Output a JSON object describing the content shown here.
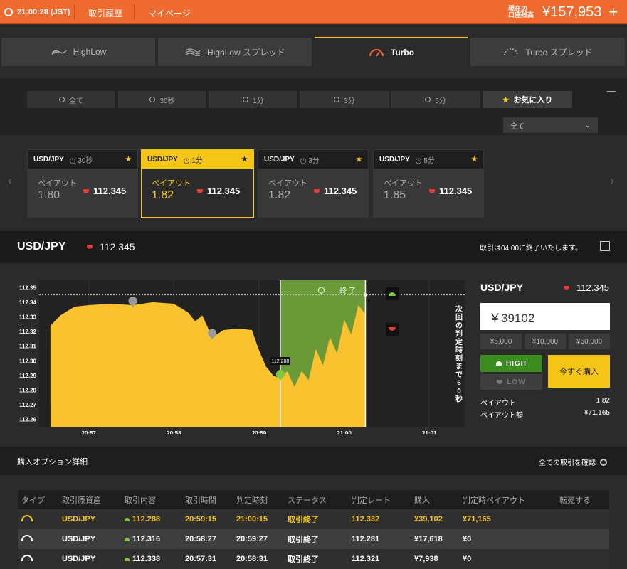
{
  "header": {
    "clock": "21:00:28 (JST)",
    "trade_history": "取引履歴",
    "my_page": "マイページ",
    "balance_label_line1": "現在の",
    "balance_label_line2": "口座残高",
    "balance": "¥157,953",
    "add_symbol": "+"
  },
  "tabs": [
    {
      "label": "HighLow"
    },
    {
      "label": "HighLow スプレッド"
    },
    {
      "label": "Turbo"
    },
    {
      "label": "Turbo スプレッド"
    }
  ],
  "filters": [
    {
      "label": "全て"
    },
    {
      "label": "30秒"
    },
    {
      "label": "1分"
    },
    {
      "label": "3分"
    },
    {
      "label": "5分"
    },
    {
      "label": "お気に入り"
    }
  ],
  "dropdown": {
    "value": "全て"
  },
  "cards": [
    {
      "pair": "USD/JPY",
      "duration": "30秒",
      "payout_label": "ペイアウト",
      "payout": "1.80",
      "rate": "112.345"
    },
    {
      "pair": "USD/JPY",
      "duration": "1分",
      "payout_label": "ペイアウト",
      "payout": "1.82",
      "rate": "112.345"
    },
    {
      "pair": "USD/JPY",
      "duration": "3分",
      "payout_label": "ペイアウト",
      "payout": "1.82",
      "rate": "112.345"
    },
    {
      "pair": "USD/JPY",
      "duration": "5分",
      "payout_label": "ペイアウト",
      "payout": "1.85",
      "rate": "112.345"
    }
  ],
  "pair_bar": {
    "pair": "USD/JPY",
    "rate": "112.345",
    "close_info": "取引は04:00に終了いたします。"
  },
  "chart": {
    "yticks": [
      "112.35",
      "112.34",
      "112.33",
      "112.32",
      "112.31",
      "112.30",
      "112.29",
      "112.28",
      "112.27",
      "112.26"
    ],
    "xticks": [
      "20:57",
      "20:58",
      "20:59",
      "21:00",
      "21:01"
    ],
    "end_label": "終 了",
    "countdown": "次回の判定時刻まで60秒",
    "entry_tag": "112.288"
  },
  "chart_data": {
    "type": "area",
    "ylim": [
      112.255,
      112.355
    ],
    "x": [
      "20:56:33",
      "20:56:40",
      "20:56:50",
      "20:57:00",
      "20:57:15",
      "20:57:31",
      "20:57:45",
      "20:58:00",
      "20:58:10",
      "20:58:15",
      "20:58:20",
      "20:58:27",
      "20:58:35",
      "20:58:45",
      "20:58:55",
      "20:59:00",
      "20:59:05",
      "20:59:10",
      "20:59:15",
      "20:59:20",
      "20:59:25",
      "20:59:30",
      "20:59:35",
      "20:59:40",
      "20:59:45",
      "20:59:50",
      "20:59:55",
      "21:00:00",
      "21:00:05",
      "21:00:10",
      "21:00:15"
    ],
    "values": [
      112.324,
      112.331,
      112.337,
      112.338,
      112.339,
      112.338,
      112.34,
      112.339,
      112.333,
      112.327,
      112.331,
      112.316,
      112.321,
      112.322,
      112.321,
      112.307,
      112.296,
      112.29,
      112.288,
      112.293,
      112.282,
      112.293,
      112.287,
      112.308,
      112.297,
      112.316,
      112.305,
      112.328,
      112.318,
      112.338,
      112.332
    ]
  },
  "trade_panel": {
    "pair": "USD/JPY",
    "rate": "112.345",
    "amount": "￥39102",
    "quick_amounts": [
      "¥5,000",
      "¥10,000",
      "¥50,000"
    ],
    "high": "HIGH",
    "low": "LOW",
    "buy": "今すぐ購入",
    "payout_label": "ペイアウト",
    "payout_value": "1.82",
    "payout_amount_label": "ペイアウト額",
    "payout_amount_value": "¥71,165"
  },
  "details": {
    "title": "購入オプション詳細",
    "link": "全ての取引を確認",
    "headers": [
      "タイプ",
      "取引原資産",
      "取引内容",
      "取引時間",
      "判定時刻",
      "ステータス",
      "判定レート",
      "購入",
      "判定時ペイアウト",
      "転売する"
    ],
    "rows": [
      {
        "asset": "USD/JPY",
        "content": "112.288",
        "time": "20:59:15",
        "judge": "21:00:15",
        "status": "取引終了",
        "rate": "112.332",
        "buy": "¥39,102",
        "payout": "¥71,165"
      },
      {
        "asset": "USD/JPY",
        "content": "112.316",
        "time": "20:58:27",
        "judge": "20:59:27",
        "status": "取引終了",
        "rate": "112.281",
        "buy": "¥17,618",
        "payout": "¥0"
      },
      {
        "asset": "USD/JPY",
        "content": "112.338",
        "time": "20:57:31",
        "judge": "20:58:31",
        "status": "取引終了",
        "rate": "112.321",
        "buy": "¥7,938",
        "payout": "¥0"
      }
    ]
  },
  "colors": {
    "accent": "#ef6a2f",
    "highlight": "#f5c518",
    "high": "#3a8c1e",
    "low": "#e53935",
    "area": "#f9c22e",
    "window": "#6a9a38"
  }
}
